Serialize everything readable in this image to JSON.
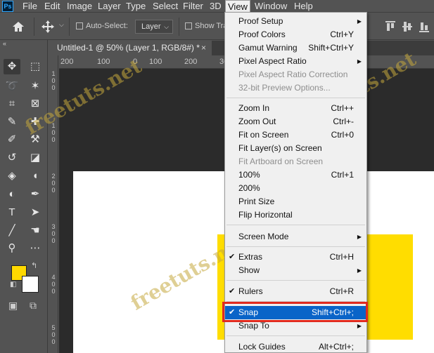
{
  "app": {
    "logo_text": "Ps"
  },
  "menubar": {
    "items": [
      {
        "label": "File"
      },
      {
        "label": "Edit"
      },
      {
        "label": "Image"
      },
      {
        "label": "Layer"
      },
      {
        "label": "Type"
      },
      {
        "label": "Select"
      },
      {
        "label": "Filter"
      },
      {
        "label": "3D"
      },
      {
        "label": "View",
        "active": true
      },
      {
        "label": "Window"
      },
      {
        "label": "Help"
      }
    ]
  },
  "options_bar": {
    "auto_select_label": "Auto-Select:",
    "layer_select_value": "Layer",
    "show_transform_label": "Show Tra"
  },
  "tab": {
    "title": "Untitled-1 @ 50% (Layer 1, RGB/8#) *",
    "close_glyph": "×"
  },
  "rulers": {
    "horizontal": [
      "200",
      "100",
      "0",
      "100",
      "200",
      "300"
    ],
    "vertical": [
      "1",
      "0",
      "0",
      "1",
      "0",
      "0",
      "2",
      "0",
      "0",
      "3",
      "0",
      "0",
      "4",
      "0",
      "0",
      "5",
      "0",
      "0"
    ]
  },
  "colors": {
    "foreground": "#ffd900",
    "background": "#ffffff",
    "highlight": "#0a64c8",
    "annotation_outline": "#e12a1f"
  },
  "view_menu": {
    "items": [
      {
        "label": "Proof Setup",
        "submenu": true
      },
      {
        "label": "Proof Colors",
        "shortcut": "Ctrl+Y"
      },
      {
        "label": "Gamut Warning",
        "shortcut": "Shift+Ctrl+Y"
      },
      {
        "label": "Pixel Aspect Ratio",
        "submenu": true
      },
      {
        "label": "Pixel Aspect Ratio Correction",
        "disabled": true
      },
      {
        "label": "32-bit Preview Options...",
        "disabled": true
      },
      {
        "label": "Zoom In",
        "shortcut": "Ctrl++"
      },
      {
        "label": "Zoom Out",
        "shortcut": "Ctrl+-"
      },
      {
        "label": "Fit on Screen",
        "shortcut": "Ctrl+0"
      },
      {
        "label": "Fit Layer(s) on Screen"
      },
      {
        "label": "Fit Artboard on Screen",
        "disabled": true
      },
      {
        "label": "100%",
        "shortcut": "Ctrl+1"
      },
      {
        "label": "200%"
      },
      {
        "label": "Print Size"
      },
      {
        "label": "Flip Horizontal"
      },
      {
        "label": "Screen Mode",
        "submenu": true
      },
      {
        "label": "Extras",
        "shortcut": "Ctrl+H",
        "checked": true
      },
      {
        "label": "Show",
        "submenu": true
      },
      {
        "label": "Rulers",
        "shortcut": "Ctrl+R",
        "checked": true
      },
      {
        "label": "Snap",
        "shortcut": "Shift+Ctrl+;",
        "checked": true,
        "highlighted": true
      },
      {
        "label": "Snap To",
        "submenu": true
      },
      {
        "label": "Lock Guides",
        "shortcut": "Alt+Ctrl+;"
      }
    ],
    "check_glyph": "✔",
    "submenu_glyph": "▶"
  },
  "watermarks": [
    "freetuts.net",
    "freetuts.net",
    "freetuts.net",
    "freetuts.net",
    "freetuts.net"
  ]
}
